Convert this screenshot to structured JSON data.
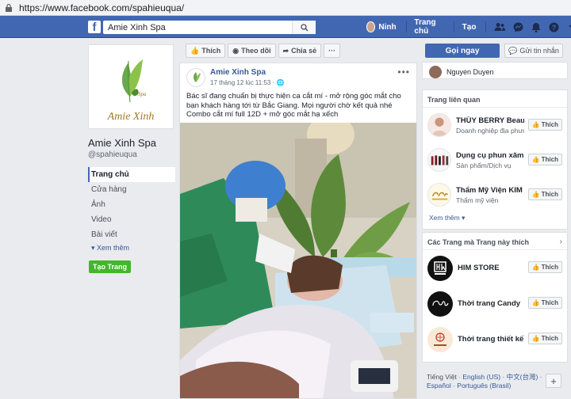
{
  "browser": {
    "url": "https://www.facebook.com/spahieuqua/"
  },
  "header": {
    "search_value": "Amie Xinh Spa",
    "user_name": "Ninh",
    "home_label": "Trang chủ",
    "create_label": "Tạo",
    "brand_color": "#4267b2"
  },
  "page": {
    "logo_text": "Amie Xinh",
    "logo_sub": "Spa",
    "name": "Amie Xinh Spa",
    "handle": "@spahieuqua",
    "nav": [
      {
        "label": "Trang chủ"
      },
      {
        "label": "Cửa hàng"
      },
      {
        "label": "Ảnh"
      },
      {
        "label": "Video"
      },
      {
        "label": "Bài viết"
      }
    ],
    "see_more": "Xem thêm",
    "create_page": "Tạo Trang"
  },
  "actions": {
    "like": "Thích",
    "follow": "Theo dõi",
    "share": "Chia sẻ",
    "more": "···"
  },
  "post": {
    "author": "Amie Xinh Spa",
    "time": "17 tháng 12 lúc 11:53 · ",
    "text_line1": "Bác sĩ đang chuẩn bị thực hiện ca cắt mí - mở rộng góc mắt cho bạn khách hàng tới từ Bắc Giang. Mọi người chờ kết quả nhé",
    "text_line2": "Combo cắt mí full 12D + mở góc mắt hạ xếch"
  },
  "right": {
    "call_button": "Gọi ngay",
    "message_button": "Gửi tin nhắn",
    "liked_by": "Nguyen Duyen",
    "related_header": "Trang liên quan",
    "related": [
      {
        "name": "THÙY BERRY Beauty...",
        "category": "Doanh nghiệp địa phương",
        "like": "Thích"
      },
      {
        "name": "Dụng cụ phun xăm N...",
        "category": "Sản phẩm/Dịch vụ",
        "like": "Thích"
      },
      {
        "name": "Thẩm Mỹ Viện KIM N...",
        "category": "Thẩm mỹ viện",
        "like": "Thích"
      }
    ],
    "related_more": "Xem thêm",
    "likes_header": "Các Trang mà Trang này thích",
    "likes": [
      {
        "name": "HIM STORE",
        "like": "Thích"
      },
      {
        "name": "Thời trang Candy",
        "like": "Thích"
      },
      {
        "name": "Thời trang thiết kế Li...",
        "like": "Thích"
      }
    ],
    "lang_current": "Tiếng Việt",
    "lang_options": "English (US) · 中文(台灣) · Español · Português (Brasil)"
  }
}
